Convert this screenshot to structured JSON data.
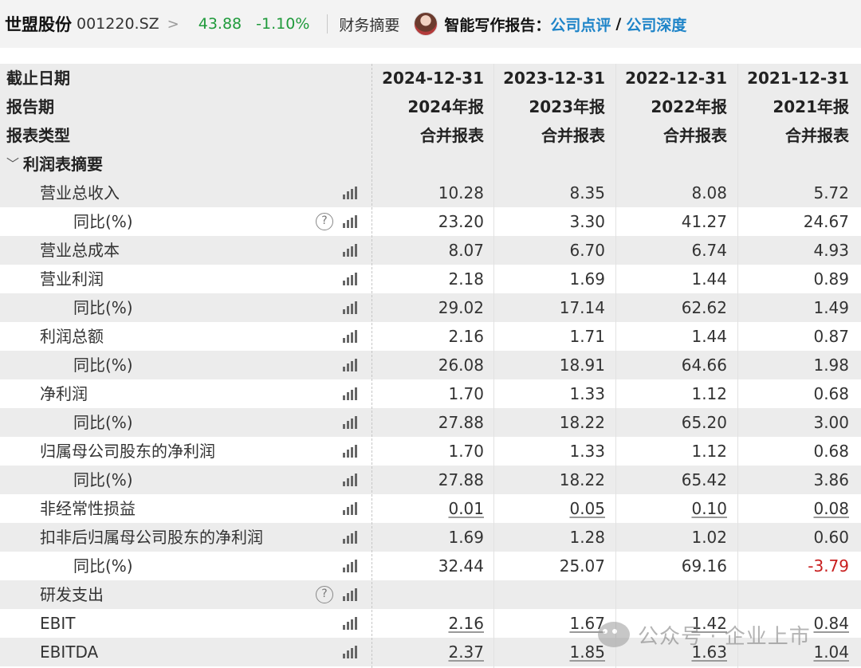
{
  "header": {
    "stock_name": "世盟股份",
    "stock_code": "001220.SZ",
    "chevron": ">",
    "price": "43.88",
    "change": "-1.10%",
    "section": "财务摘要",
    "ai_label": "智能写作报告：",
    "ai_link_1": "公司点评",
    "ai_slash": "/",
    "ai_link_2": "公司深度",
    "price_color": "#1f9a3b",
    "link_color": "#1e84c8"
  },
  "table": {
    "header_rows": [
      {
        "label": "截止日期",
        "values": [
          "2024-12-31",
          "2023-12-31",
          "2022-12-31",
          "2021-12-31"
        ]
      },
      {
        "label": "报告期",
        "values": [
          "2024年报",
          "2023年报",
          "2022年报",
          "2021年报"
        ]
      },
      {
        "label": "报表类型",
        "values": [
          "合并报表",
          "合并报表",
          "合并报表",
          "合并报表"
        ]
      }
    ],
    "section": {
      "icon": "chevron-down-icon",
      "glyph": "﹀",
      "label": "利润表摘要"
    },
    "rows": [
      {
        "label": "营业总收入",
        "values": [
          "10.28",
          "8.35",
          "8.08",
          "5.72"
        ]
      },
      {
        "label": "同比(%)",
        "values": [
          "23.20",
          "3.30",
          "41.27",
          "24.67"
        ]
      },
      {
        "label": "营业总成本",
        "values": [
          "8.07",
          "6.70",
          "6.74",
          "4.93"
        ]
      },
      {
        "label": "营业利润",
        "values": [
          "2.18",
          "1.69",
          "1.44",
          "0.89"
        ]
      },
      {
        "label": "同比(%)",
        "values": [
          "29.02",
          "17.14",
          "62.62",
          "1.49"
        ]
      },
      {
        "label": "利润总额",
        "values": [
          "2.16",
          "1.71",
          "1.44",
          "0.87"
        ]
      },
      {
        "label": "同比(%)",
        "values": [
          "26.08",
          "18.91",
          "64.66",
          "1.98"
        ]
      },
      {
        "label": "净利润",
        "values": [
          "1.70",
          "1.33",
          "1.12",
          "0.68"
        ]
      },
      {
        "label": "同比(%)",
        "values": [
          "27.88",
          "18.22",
          "65.20",
          "3.00"
        ]
      },
      {
        "label": "归属母公司股东的净利润",
        "values": [
          "1.70",
          "1.33",
          "1.12",
          "0.68"
        ]
      },
      {
        "label": "同比(%)",
        "values": [
          "27.88",
          "18.22",
          "65.42",
          "3.86"
        ]
      },
      {
        "label": "非经常性损益",
        "values": [
          "0.01",
          "0.05",
          "0.10",
          "0.08"
        ]
      },
      {
        "label": "扣非后归属母公司股东的净利润",
        "values": [
          "1.69",
          "1.28",
          "1.02",
          "0.60"
        ]
      },
      {
        "label": "同比(%)",
        "values": [
          "32.44",
          "25.07",
          "69.16",
          "-3.79"
        ]
      },
      {
        "label": "研发支出",
        "values": [
          "",
          "",
          "",
          ""
        ]
      },
      {
        "label": "EBIT",
        "values": [
          "2.16",
          "1.67",
          "1.42",
          "0.84"
        ]
      },
      {
        "label": "EBITDA",
        "values": [
          "2.37",
          "1.85",
          "1.63",
          "1.04"
        ]
      }
    ],
    "negative_color": "#c81e1e",
    "help_glyph": "?"
  },
  "watermark": {
    "text": "公众号 · 企业上市"
  }
}
